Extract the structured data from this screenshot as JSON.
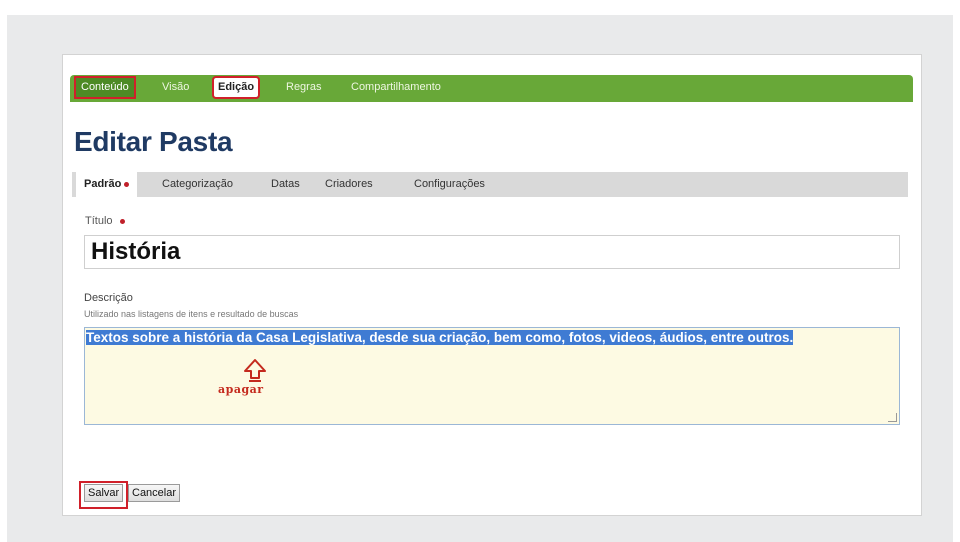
{
  "editbar": {
    "items": [
      {
        "label": "Conteúdo"
      },
      {
        "label": "Visão"
      },
      {
        "label": "Edição"
      },
      {
        "label": "Regras"
      },
      {
        "label": "Compartilhamento"
      }
    ]
  },
  "page_title": "Editar Pasta",
  "tabs": [
    {
      "label": "Padrão"
    },
    {
      "label": "Categorização"
    },
    {
      "label": "Datas"
    },
    {
      "label": "Criadores"
    },
    {
      "label": "Configurações"
    }
  ],
  "form": {
    "title_label": "Título",
    "title_value": "História",
    "description_label": "Descrição",
    "description_hint": "Utilizado nas listagens de itens e resultado de buscas",
    "description_value": "Textos sobre a história da Casa Legislativa, desde sua criação, bem como, fotos, videos, áudios, entre outros."
  },
  "annotation": {
    "text": "apagar",
    "color": "#c42a1e"
  },
  "buttons": {
    "save": "Salvar",
    "cancel": "Cancelar"
  },
  "colors": {
    "editbar_green": "#68a838",
    "highlight_red": "#d0202a",
    "selection_blue": "#3f7bd3",
    "textarea_bg": "#fdfae3"
  }
}
